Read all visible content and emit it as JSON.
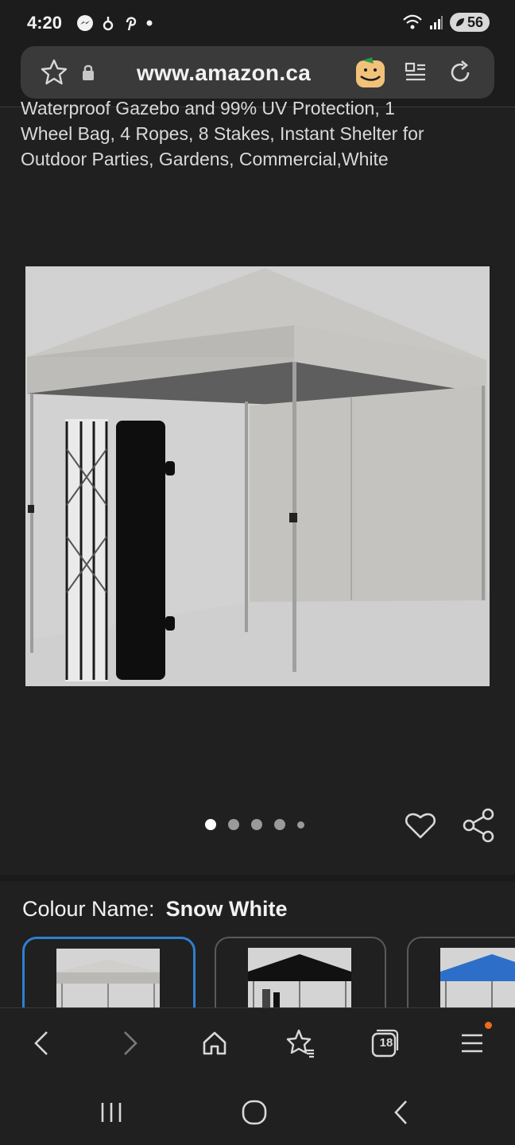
{
  "status_bar": {
    "time": "4:20",
    "battery": "56",
    "left_icons": [
      "messenger-icon",
      "threads-icon",
      "pinterest-icon",
      "dot-icon"
    ],
    "right_icons": [
      "wifi-icon",
      "signal-icon",
      "battery-icon"
    ]
  },
  "browser": {
    "url": "www.amazon.ca",
    "tabs_count": "18"
  },
  "product": {
    "title_lines": [
      "Waterproof Gazebo and 99% UV Protection, 1",
      "Wheel Bag, 4 Ropes, 8 Stakes, Instant Shelter for",
      "Outdoor Parties, Gardens, Commercial,White"
    ],
    "carousel": {
      "total": 5,
      "active_index": 0
    },
    "colour_label": "Colour Name:",
    "colour_value": "Snow White",
    "swatches": [
      {
        "colour": "#f0f0ee",
        "selected": true
      },
      {
        "colour": "#111111",
        "selected": false
      },
      {
        "colour": "#2d6fc8",
        "selected": false
      }
    ]
  },
  "colors": {
    "accent": "#2f7fd0",
    "background": "#202020",
    "notification": "#f06a1a"
  }
}
